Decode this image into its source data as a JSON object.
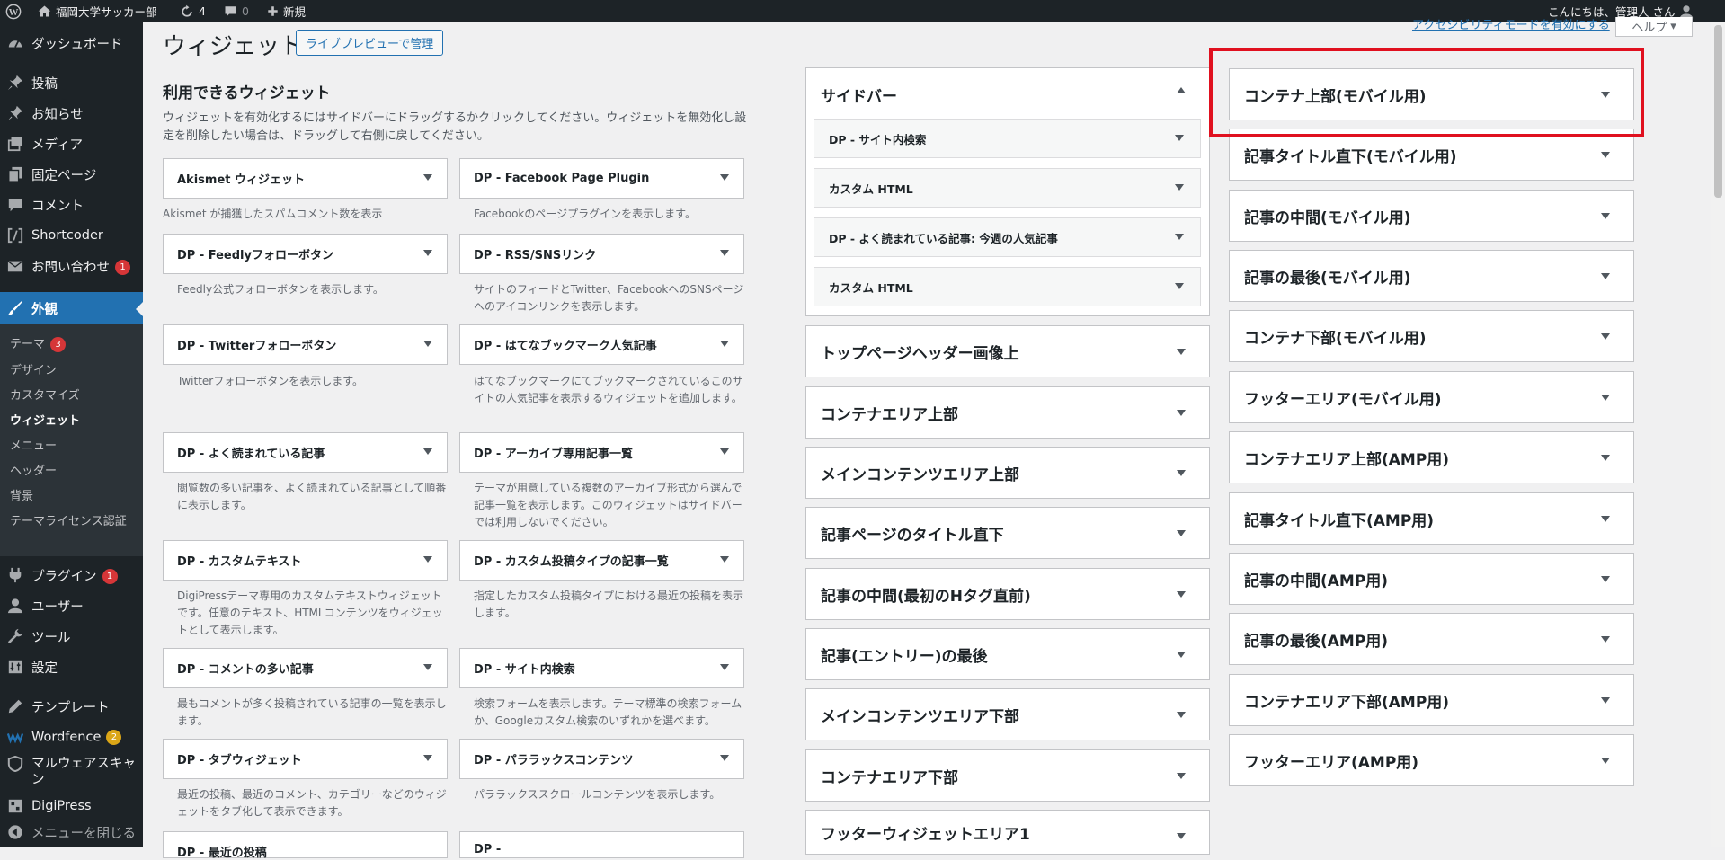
{
  "adminbar": {
    "site_name": "福岡大学サッカー部",
    "updates": "4",
    "comments": "0",
    "new_label": "新規",
    "greeting": "こんにちは、管理人 さん"
  },
  "sidebar": {
    "dashboard": "ダッシュボード",
    "posts": "投稿",
    "news": "お知らせ",
    "media": "メディア",
    "pages": "固定ページ",
    "comments": "コメント",
    "shortcoder": "Shortcoder",
    "contact": "お問い合わせ",
    "contact_badge": "1",
    "appearance": "外観",
    "sub": {
      "themes": "テーマ",
      "themes_badge": "3",
      "design": "デザイン",
      "customize": "カスタマイズ",
      "widgets": "ウィジェット",
      "menus": "メニュー",
      "header": "ヘッダー",
      "background": "背景",
      "license": "テーマライセンス認証"
    },
    "plugins": "プラグイン",
    "plugins_badge": "1",
    "users": "ユーザー",
    "tools": "ツール",
    "settings": "設定",
    "template": "テンプレート",
    "wordfence": "Wordfence",
    "wordfence_badge": "2",
    "malware_1": "マルウェアスキャ",
    "malware_2": "ン",
    "digipress": "DigiPress",
    "collapse": "メニューを閉じる"
  },
  "header": {
    "title": "ウィジェット",
    "live_preview": "ライブプレビューで管理",
    "top_link": "アクセシビリティモードを有効にする",
    "help": "ヘルプ"
  },
  "available": {
    "title": "利用できるウィジェット",
    "desc": "ウィジェットを有効化するにはサイドバーにドラッグするかクリックしてください。ウィジェットを無効化し設定を削除したい場合は、ドラッグして右側に戻してください。",
    "widgets": [
      {
        "title": "Akismet ウィジェット",
        "desc": "Akismet が捕獲したスパムコメント数を表示"
      },
      {
        "title": "DP - Facebook Page Plugin",
        "desc": "Facebookのページプラグインを表示します。"
      },
      {
        "title": "DP - Feedlyフォローボタン",
        "desc": "Feedly公式フォローボタンを表示します。"
      },
      {
        "title": "DP - RSS/SNSリンク",
        "desc": "サイトのフィードとTwitter、FacebookへのSNSページへのアイコンリンクを表示します。"
      },
      {
        "title": "DP - Twitterフォローボタン",
        "desc": "Twitterフォローボタンを表示します。"
      },
      {
        "title": "DP - はてなブックマーク人気記事",
        "desc": "はてなブックマークにてブックマークされているこのサイトの人気記事を表示するウィジェットを追加します。"
      },
      {
        "title": "DP - よく読まれている記事",
        "desc": "閲覧数の多い記事を、よく読まれている記事として順番に表示します。"
      },
      {
        "title": "DP - アーカイブ専用記事一覧",
        "desc": "テーマが用意している複数のアーカイブ形式から選んで記事一覧を表示します。このウィジェットはサイドバーでは利用しないでください。"
      },
      {
        "title": "DP - カスタムテキスト",
        "desc": "DigiPressテーマ専用のカスタムテキストウィジェットです。任意のテキスト、HTMLコンテンツをウィジェットとして表示します。"
      },
      {
        "title": "DP - カスタム投稿タイプの記事一覧",
        "desc": "指定したカスタム投稿タイプにおける最近の投稿を表示します。"
      },
      {
        "title": "DP - コメントの多い記事",
        "desc": "最もコメントが多く投稿されている記事の一覧を表示します。"
      },
      {
        "title": "DP - サイト内検索",
        "desc": "検索フォームを表示します。テーマ標準の検索フォームか、Googleカスタム検索のいずれかを選べます。"
      },
      {
        "title": "DP - タブウィジェット",
        "desc": "最近の投稿、最近のコメント、カテゴリーなどのウィジェットをタブ化して表示できます。"
      },
      {
        "title": "DP - パララックスコンテンツ",
        "desc": "パララックススクロールコンテンツを表示します。"
      },
      {
        "title": "DP - 最近の投稿",
        "desc": ""
      },
      {
        "title": "DP - ",
        "desc": ""
      }
    ]
  },
  "sidebar_open": {
    "title": "サイドバー",
    "widgets": [
      "DP - サイト内検索",
      "カスタム HTML",
      "DP - よく読まれている記事: 今週の人気記事",
      "カスタム HTML"
    ]
  },
  "areas_mid": [
    "トップページヘッダー画像上",
    "コンテナエリア上部",
    "メインコンテンツエリア上部",
    "記事ページのタイトル直下",
    "記事の中間(最初のHタグ直前)",
    "記事(エントリー)の最後",
    "メインコンテンツエリア下部",
    "コンテナエリア下部",
    "フッターウィジェットエリア1"
  ],
  "areas_right": [
    "コンテナ上部(モバイル用)",
    "記事タイトル直下(モバイル用)",
    "記事の中間(モバイル用)",
    "記事の最後(モバイル用)",
    "コンテナ下部(モバイル用)",
    "フッターエリア(モバイル用)",
    "コンテナエリア上部(AMP用)",
    "記事タイトル直下(AMP用)",
    "記事の中間(AMP用)",
    "記事の最後(AMP用)",
    "コンテナエリア下部(AMP用)",
    "フッターエリア(AMP用)"
  ],
  "colors": {
    "admin_bg": "#1d2327",
    "accent": "#2271b1",
    "highlight": "#e0101f",
    "badge": "#d63638"
  }
}
